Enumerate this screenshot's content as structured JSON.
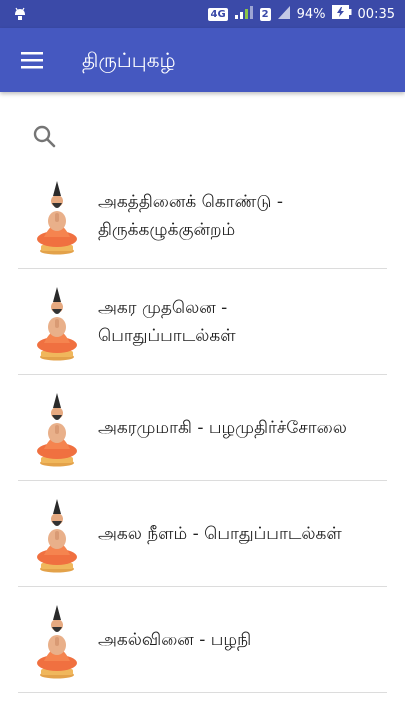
{
  "status_bar": {
    "network_label": "4G",
    "sim1_label": "1",
    "sim2_label": "2",
    "battery_percent": "94%",
    "time": "00:35",
    "icons": [
      "android-debug-icon",
      "signal-icon",
      "battery-charging-icon"
    ]
  },
  "app_bar": {
    "title": "திருப்புகழ்",
    "menu_icon": "hamburger-menu-icon"
  },
  "search": {
    "icon": "search-icon"
  },
  "colors": {
    "status_bar": "#3b4aa8",
    "app_bar": "#4558c0",
    "divider": "#dcdcdc",
    "text": "#212121"
  },
  "songs": [
    {
      "title_line1": "அகத்தினைக் கொண்டு -",
      "title_line2": "திருக்கழுக்குன்றம்",
      "thumbnail": "saint-arunagirinathar-icon"
    },
    {
      "title_line1": "அகர முதலென -",
      "title_line2": "பொதுப்பாடல்கள்",
      "thumbnail": "saint-arunagirinathar-icon"
    },
    {
      "title_line1": "அகரமுமாகி - பழமுதிர்ச்சோலை",
      "title_line2": "",
      "thumbnail": "saint-arunagirinathar-icon"
    },
    {
      "title_line1": "அகல நீளம் - பொதுப்பாடல்கள்",
      "title_line2": "",
      "thumbnail": "saint-arunagirinathar-icon"
    },
    {
      "title_line1": "அகல்வினை - பழநி",
      "title_line2": "",
      "thumbnail": "saint-arunagirinathar-icon"
    }
  ]
}
